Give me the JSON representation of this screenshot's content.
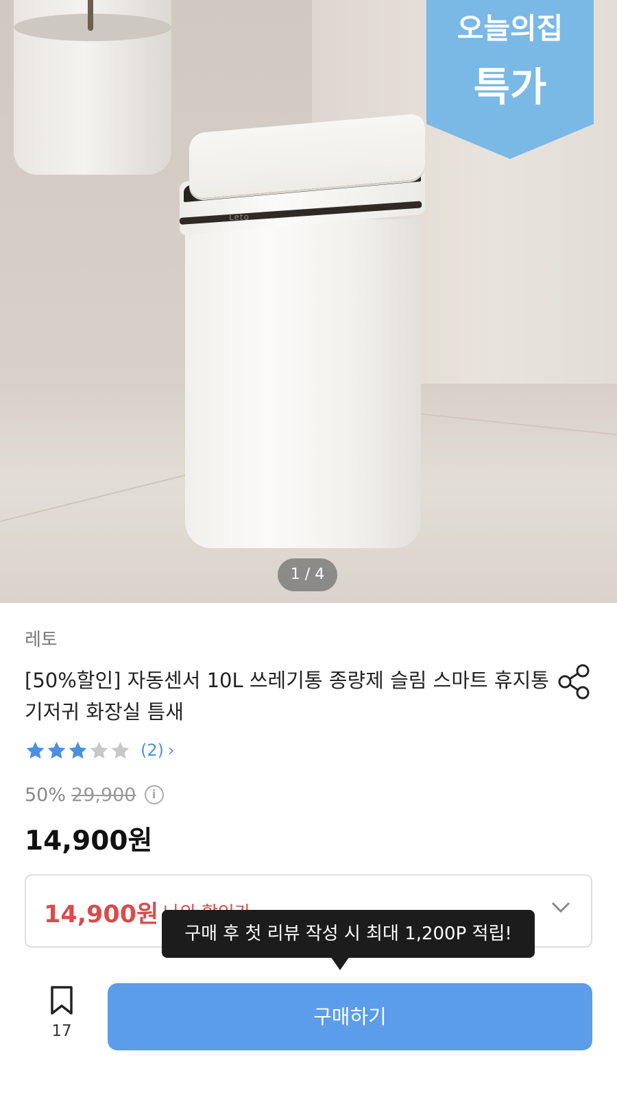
{
  "hero": {
    "badge_line1": "오늘의집",
    "badge_line2": "특가",
    "product_logo": "Leto",
    "image_counter": "1 / 4"
  },
  "product": {
    "brand": "레토",
    "title": "[50%할인] 자동센서 10L 쓰레기통 종량제 슬림 스마트 휴지통 기저귀 화장실 틈새",
    "rating_stars": 3,
    "rating_max": 5,
    "review_count": "(2)",
    "discount_percent": "50%",
    "original_price": "29,900",
    "sale_price": "14,900원"
  },
  "coupon": {
    "price": "14,900원",
    "label": "나의 할인가"
  },
  "tooltip": {
    "text": "구매 후 첫 리뷰 작성 시 최대 1,200P 적립!"
  },
  "bottom_bar": {
    "bookmark_count": "17",
    "buy_label": "구매하기"
  },
  "colors": {
    "accent_blue": "#5b9de8",
    "star_blue": "#4a90e2",
    "badge_blue": "#7ab8e6",
    "price_red": "#d94c4c"
  }
}
